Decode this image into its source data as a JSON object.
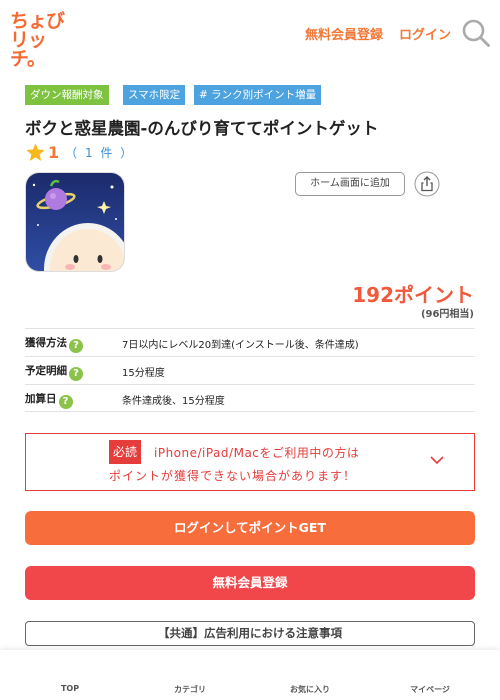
{
  "header": {
    "logo_line1": "ちょび",
    "logo_line2": "リッチ。",
    "register_link": "無料会員登録",
    "login_link": "ログイン"
  },
  "tags": [
    "ダウン報酬対象",
    "スマホ限定",
    "# ランク別ポイント増量"
  ],
  "app": {
    "title": "ボクと惑星農園-のんびり育ててポイントゲット",
    "rating": "1",
    "rating_count": "（ 1 件 ）",
    "home_button": "ホーム画面に追加",
    "points": "192ポイント",
    "yen": "(96円相当)"
  },
  "info": [
    {
      "label": "獲得方法",
      "value": "7日以内にレベル20到達(インストール後、条件達成)"
    },
    {
      "label": "予定明細",
      "value": "15分程度"
    },
    {
      "label": "加算日",
      "value": "条件達成後、15分程度"
    }
  ],
  "notice": {
    "badge": "必読",
    "line1": "iPhone/iPad/Macをご利用中の方は",
    "line2": "ポイントが獲得できない場合があります！"
  },
  "buttons": {
    "login_get": "ログインしてポイントGET",
    "register": "無料会員登録",
    "caution": "【共通】広告利用における注意事項"
  },
  "bottom_nav": [
    "TOP",
    "カテゴリ",
    "お気に入り",
    "マイページ"
  ],
  "colors": {
    "brand_orange": "#f27838",
    "points_red": "#ef5a3c",
    "notice_red": "#e53c3c",
    "tag_green": "#7dc33f",
    "tag_blue": "#4ca3e0",
    "login_button": "#f76e3c",
    "register_button": "#f1474b"
  },
  "icons": [
    "search-icon",
    "star-icon",
    "question-icon",
    "share-icon",
    "chevron-down-icon",
    "app-icon"
  ]
}
